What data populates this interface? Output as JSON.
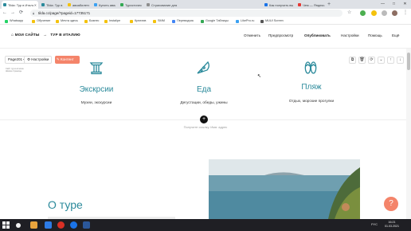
{
  "browser": {
    "tabs": [
      {
        "label": "Tilda: Тур в Италию",
        "color": "#2b8a9b",
        "active": true
      },
      {
        "label": "Tilda: Тур в Италию",
        "color": "#2b8a9b"
      },
      {
        "label": "авиабилеты — Я",
        "color": "#f4c20d"
      },
      {
        "label": "Купить авиабиле",
        "color": "#3ba1f2"
      },
      {
        "label": "Туристические с",
        "color": "#34a853"
      },
      {
        "label": "Страхование для",
        "color": "#8e8e8e"
      },
      {
        "label": "Как получить вы",
        "color": "#1a73e8"
      },
      {
        "label": "Чем — Яндекс.В",
        "color": "#e53935"
      }
    ],
    "new_tab": "+",
    "window_controls": [
      "—",
      "□",
      "✕"
    ],
    "url": "tilda.cc/page/?pageid=17735171",
    "bookmarks": [
      {
        "label": "Whatsapp",
        "color": "#25d366"
      },
      {
        "label": "Обучение",
        "color": "#f4c20d"
      },
      {
        "label": "Мечта здесь",
        "color": "#f4c20d"
      },
      {
        "label": "Бизнес",
        "color": "#f4c20d"
      },
      {
        "label": "Instalipe",
        "color": "#f4c20d"
      },
      {
        "label": "Креатив",
        "color": "#f4c20d"
      },
      {
        "label": "SMM",
        "color": "#f4c20d"
      },
      {
        "label": "Переводчик",
        "color": "#4285f4"
      },
      {
        "label": "Google Таблицы",
        "color": "#34a853"
      },
      {
        "label": "LikePro.ru",
        "color": "#3ba1f2"
      },
      {
        "label": "MUUI Screen",
        "color": "#555555"
      }
    ]
  },
  "tilda": {
    "breadcrumb_home": "МОИ САЙТЫ",
    "breadcrumb_arrow": "→",
    "breadcrumb_current": "ТУР В ИТАЛИЮ",
    "top_links": [
      "Отменить",
      "Предпросмотр",
      "Опубликовать",
      "Настройки",
      "Помощь",
      "Ещё"
    ],
    "page_select": "Page201",
    "settings_btn": "Настройки",
    "content_btn": "Контент",
    "tiny_label": "Сайт тур-в-италию",
    "tiny_label2": "Шапка страницы",
    "controls": [
      "⧉",
      "🗑",
      "⟳",
      "⌄",
      "↑",
      "↓"
    ]
  },
  "features": [
    {
      "title": "Экскрсии",
      "subtitle": "Музеи, экскурсии",
      "icon": "column-icon"
    },
    {
      "title": "Еда",
      "subtitle": "Дегустации, обеды, ужины",
      "icon": "pizza-icon"
    },
    {
      "title": "Пляж",
      "subtitle": "Отдых, морские прогулки",
      "icon": "flip-flops-icon"
    }
  ],
  "add_block": "+",
  "hint": "Получите ссылку. Имя: адрес",
  "about": {
    "title": "О туре"
  },
  "help": "?",
  "taskbar": {
    "lang": "РУС",
    "time": "16:21",
    "date": "01.03.2021",
    "apps": [
      "#f2f2f2",
      "#e8a33d",
      "#2d7be5",
      "#d93025",
      "#1a73e8",
      "#2b579a"
    ]
  },
  "colors": {
    "accent": "#2b8a9b",
    "orange": "#f4846a"
  }
}
